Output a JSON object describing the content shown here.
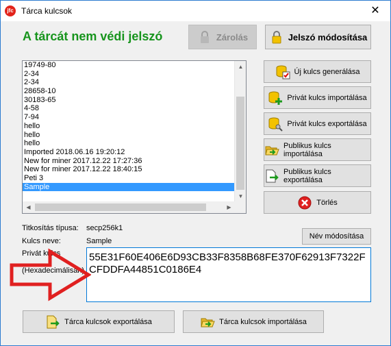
{
  "window": {
    "title": "Tárca kulcsok",
    "close_glyph": "✕",
    "app_icon_text": "jfc"
  },
  "heading": "A tárcát nem védi jelszó",
  "top_buttons": {
    "lock_label": "Zárolás",
    "change_password_label": "Jelszó módosítása"
  },
  "key_list": {
    "items": [
      "19749-80",
      "2-34",
      "2-34",
      "28658-10",
      "30183-65",
      "4-58",
      "7-94",
      "hello",
      "hello",
      "hello",
      "Imported 2018.06.16 19:20:12",
      "New for miner 2017.12.22 17:27:36",
      "New for miner 2017.12.22 18:40:15",
      "Peti 3",
      "Sample"
    ],
    "selected_index": 14
  },
  "side_buttons": {
    "generate_label": "Új kulcs generálása",
    "import_private_label": "Privát kulcs importálása",
    "export_private_label": "Privát kulcs exportálása",
    "import_public_label": "Publikus kulcs importálása",
    "export_public_label": "Publikus kulcs exportálása",
    "delete_label": "Törlés"
  },
  "details": {
    "encryption_type_label": "Titkosítás típusa:",
    "encryption_type_value": "secp256k1",
    "key_name_label": "Kulcs neve:",
    "key_name_value": "Sample",
    "private_key_label": "Privát kulcs",
    "hex_label": "(Hexadecimálisan)",
    "rename_button": "Név módosítása",
    "private_key_hex": "55E31F60E406E6D93CB33F8358B68FE370F62913F7322FCFDDFA44851C0186E4"
  },
  "bottom_buttons": {
    "export_wallet_keys": "Tárca kulcsok exportálása",
    "import_wallet_keys": "Tárca kulcsok importálása"
  },
  "colors": {
    "heading": "#16941c",
    "selection": "#3399ff",
    "annotation_arrow": "#e02020",
    "delete_icon": "#e02020"
  },
  "icons": {
    "lock": "padlock-icon",
    "key_generate": "db-check-icon",
    "key_import": "db-plus-icon",
    "key_export": "db-key-icon",
    "public_import": "folder-open-icon",
    "public_export": "file-export-icon",
    "delete": "x-circle-icon"
  }
}
